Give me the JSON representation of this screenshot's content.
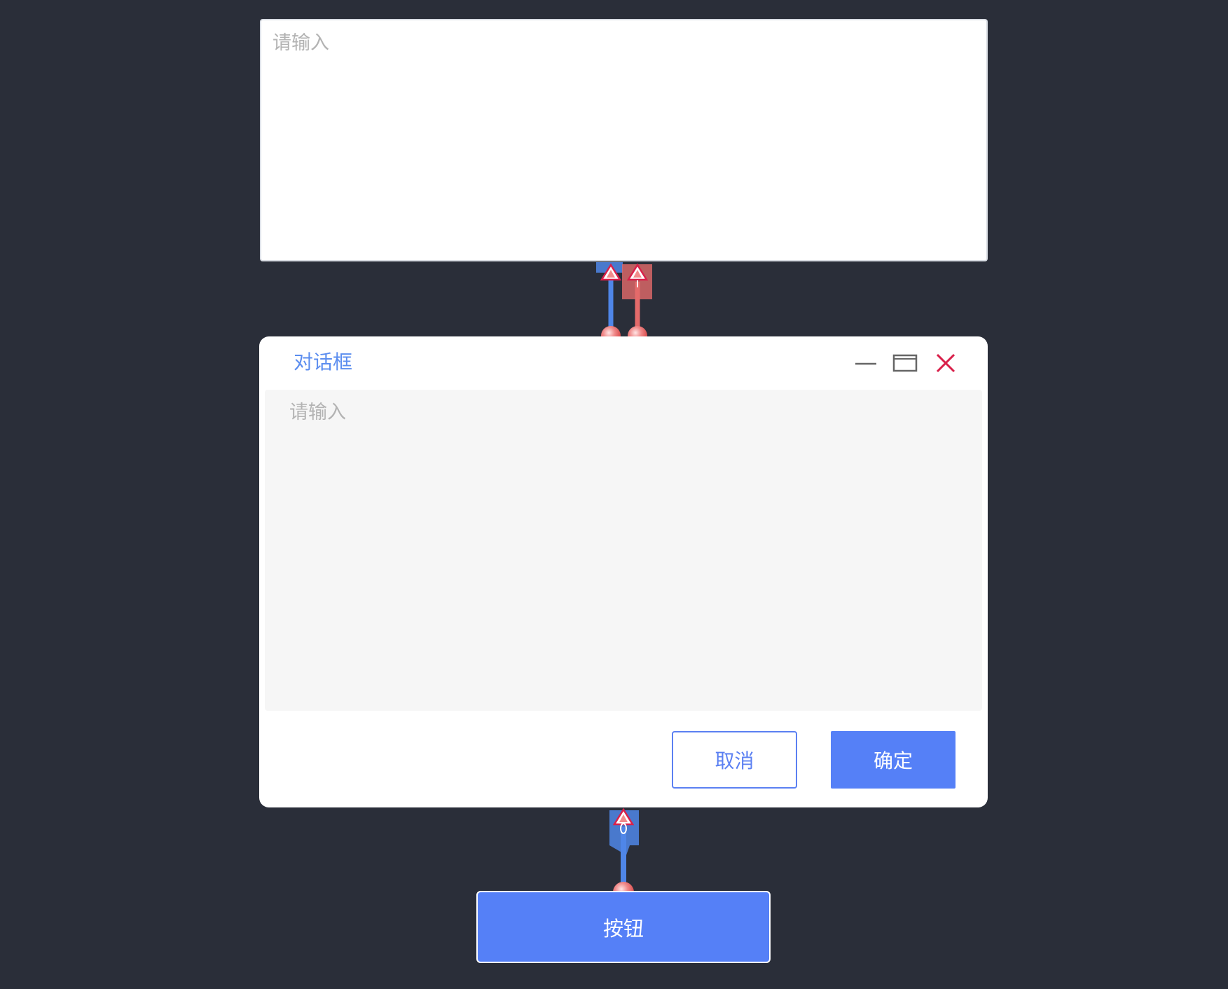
{
  "top_input": {
    "placeholder": "请输入",
    "value": ""
  },
  "dialog": {
    "title": "对话框",
    "controls": {
      "minimize_icon": "minimize-icon",
      "maximize_icon": "maximize-icon",
      "close_icon": "close-icon"
    },
    "input": {
      "placeholder": "请输入",
      "value": ""
    },
    "cancel_label": "取消",
    "ok_label": "确定"
  },
  "main_button": {
    "label": "按钮"
  },
  "colors": {
    "background": "#2a2e39",
    "primary": "#5580f7",
    "title_blue": "#5b8def",
    "close_red": "#d9204a",
    "connector_blue": "#4f86e8",
    "connector_red": "#e46a6a"
  }
}
